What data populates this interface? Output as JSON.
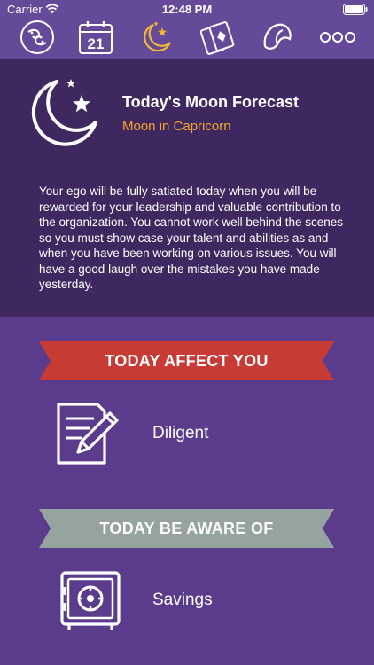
{
  "status_bar": {
    "carrier": "Carrier",
    "time": "12:48 PM",
    "icons": [
      "wifi-icon",
      "battery-icon"
    ]
  },
  "tab_bar": {
    "tabs": [
      {
        "icon": "zodiac-pisces-icon",
        "label": ""
      },
      {
        "icon": "calendar-icon",
        "label": "21"
      },
      {
        "icon": "moon-star-icon",
        "label": "",
        "selected": true
      },
      {
        "icon": "tarot-cards-icon",
        "label": ""
      },
      {
        "icon": "fortune-cookie-icon",
        "label": ""
      },
      {
        "icon": "more-icon",
        "label": ""
      }
    ],
    "accent": "#f4b731"
  },
  "forecast": {
    "title": "Today's Moon Forecast",
    "subtitle": "Moon in Capricorn",
    "body": "Your ego will be fully satiated today when you will be rewarded for your leadership and valuable contribution to the organization. You cannot work well behind the scenes so you must show case your talent and abilities as and when you have been working on various issues. You will have a good laugh over the mistakes you have made yesterday.",
    "subtitle_color": "#f4a62a"
  },
  "sections": {
    "affect": {
      "heading": "TODAY AFFECT YOU",
      "banner_color": "#c73b34",
      "item_label": "Diligent",
      "item_icon": "notepad-pencil-icon"
    },
    "aware": {
      "heading": "TODAY BE AWARE OF",
      "banner_color": "#95a3a1",
      "item_label": "Savings",
      "item_icon": "safe-icon"
    }
  },
  "colors": {
    "background": "#5b3b8c",
    "forecast_background": "#3f2860",
    "top_bar": "#654a99"
  }
}
